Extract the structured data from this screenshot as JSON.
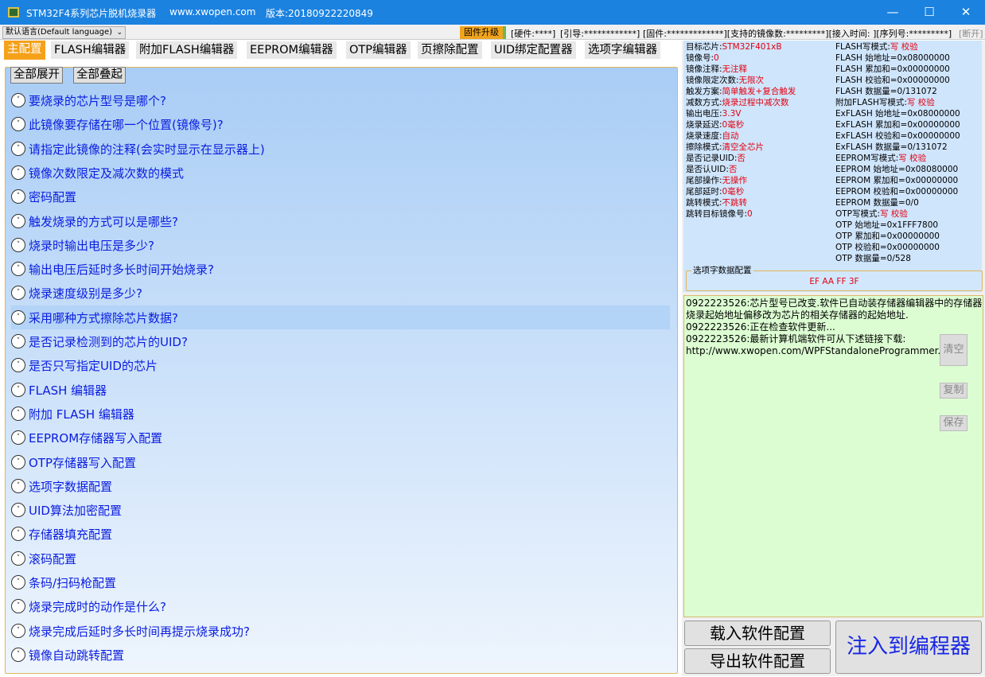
{
  "titlebar": {
    "app_title": "STM32F4系列芯片脱机烧录器",
    "website": "www.xwopen.com",
    "version": "版本:20180922220849"
  },
  "statusbar": {
    "language": "默认语言(Default language)",
    "firmware_upgrade": "固件升级",
    "hardware": "[硬件:****]",
    "bootloader": "[引导:************]",
    "firmware": "[固件:*************][支持的镜像数:*********][接入时间: ][序列号:*********]",
    "disconnect": "[断开]"
  },
  "tabs": [
    {
      "label": "主配置"
    },
    {
      "label": "FLASH编辑器"
    },
    {
      "label": "附加FLASH编辑器"
    },
    {
      "label": "EEPROM编辑器"
    },
    {
      "label": "OTP编辑器"
    },
    {
      "label": "页擦除配置"
    },
    {
      "label": "UID绑定配置器"
    },
    {
      "label": "选项字编辑器"
    }
  ],
  "buttons": {
    "expand_all": "全部展开",
    "collapse_all": "全部叠起",
    "load_config": "载入软件配置",
    "export_config": "导出软件配置",
    "inject": "注入到编程器",
    "clear": "清空",
    "copy": "复制",
    "save": "保存"
  },
  "expanders": [
    "要烧录的芯片型号是哪个?",
    "此镜像要存储在哪一个位置(镜像号)?",
    "请指定此镜像的注释(会实时显示在显示器上)",
    "镜像次数限定及减次数的模式",
    "密码配置",
    "触发烧录的方式可以是哪些?",
    "烧录时输出电压是多少?",
    "输出电压后延时多长时间开始烧录?",
    "烧录速度级别是多少?",
    "采用哪种方式擦除芯片数据?",
    "是否记录检测到的芯片的UID?",
    "是否只写指定UID的芯片",
    "FLASH 编辑器",
    "附加 FLASH 编辑器",
    "EEPROM存储器写入配置",
    "OTP存储器写入配置",
    "选项字数据配置",
    "UID算法加密配置",
    "存储器填充配置",
    "滚码配置",
    "条码/扫码枪配置",
    "烧录完成时的动作是什么?",
    "烧录完成后延时多长时间再提示烧录成功?",
    "镜像自动跳转配置"
  ],
  "info_left": [
    {
      "k": "目标芯片:",
      "v": "STM32F401xB"
    },
    {
      "k": "镜像号:",
      "v": "0"
    },
    {
      "k": "镜像注释:",
      "v": "无注释"
    },
    {
      "k": "镜像限定次数:",
      "v": "无限次"
    },
    {
      "k": "触发方案:",
      "v": "简单触发+复合触发"
    },
    {
      "k": "减数方式:",
      "v": "烧录过程中减次数"
    },
    {
      "k": "输出电压:",
      "v": "3.3V"
    },
    {
      "k": "烧录延迟:",
      "v": "0毫秒"
    },
    {
      "k": "烧录速度:",
      "v": "自动"
    },
    {
      "k": "擦除模式:",
      "v": "清空全芯片"
    },
    {
      "k": "是否记录UID:",
      "v": "否"
    },
    {
      "k": "是否认UID:",
      "v": "否"
    },
    {
      "k": "尾部操作:",
      "v": "无操作"
    },
    {
      "k": "尾部延时:",
      "v": "0毫秒"
    },
    {
      "k": "跳转模式:",
      "v": "不跳转"
    },
    {
      "k": "跳转目标镜像号:",
      "v": "0"
    }
  ],
  "info_right": [
    {
      "k": "FLASH写模式:",
      "v": "写 校验"
    },
    {
      "k": "FLASH 始地址=0x08000000",
      "v": ""
    },
    {
      "k": "FLASH 累加和=0x00000000",
      "v": ""
    },
    {
      "k": "FLASH 校验和=0x00000000",
      "v": ""
    },
    {
      "k": "FLASH 数据量=0/131072",
      "v": ""
    },
    {
      "k": "附加FLASH写模式:",
      "v": "写 校验"
    },
    {
      "k": "ExFLASH 始地址=0x08000000",
      "v": ""
    },
    {
      "k": "ExFLASH 累加和=0x00000000",
      "v": ""
    },
    {
      "k": "ExFLASH 校验和=0x00000000",
      "v": ""
    },
    {
      "k": "ExFLASH 数据量=0/131072",
      "v": ""
    },
    {
      "k": "EEPROM写模式:",
      "v": "写 校验"
    },
    {
      "k": "EEPROM 始地址=0x08080000",
      "v": ""
    },
    {
      "k": "EEPROM 累加和=0x00000000",
      "v": ""
    },
    {
      "k": "EEPROM 校验和=0x00000000",
      "v": ""
    },
    {
      "k": "EEPROM 数据量=0/0",
      "v": ""
    },
    {
      "k": "OTP写模式:",
      "v": "写 校验"
    },
    {
      "k": "OTP 始地址=0x1FFF7800",
      "v": ""
    },
    {
      "k": "OTP 累加和=0x00000000",
      "v": ""
    },
    {
      "k": "OTP 校验和=0x00000000",
      "v": ""
    },
    {
      "k": "OTP 数据量=0/528",
      "v": ""
    }
  ],
  "option_bytes": {
    "legend": "选项字数据配置",
    "value": "EF AA FF 3F"
  },
  "log": [
    "0922223526:芯片型号已改变.软件已自动装存储器编辑器中的存储器",
    "烧录起始地址偏移改为芯片的相关存储器的起始地址.",
    "0922223526:正在检查软件更新...",
    "0922223526:最新计算机端软件可从下述链接下载:",
    "http://www.xwopen.com/WPFStandaloneProgrammer.html"
  ],
  "colors": {
    "titlebar": "#1b82e0",
    "active_tab": "#f5a11a",
    "expander_text": "#0a1de0",
    "value_red": "#e4000e",
    "log_bg": "#dcfdd2",
    "info_bg": "#cfe5fc"
  }
}
